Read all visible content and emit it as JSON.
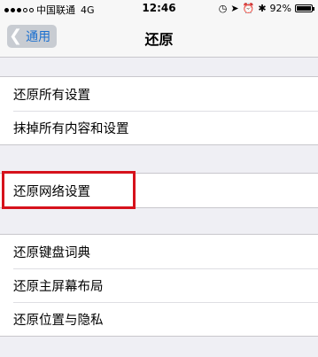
{
  "status_bar": {
    "carrier": "中国联通",
    "network": "4G",
    "time": "12:46",
    "battery": "92%"
  },
  "nav": {
    "back_label": "通用",
    "title": "还原"
  },
  "groups": [
    {
      "items": [
        "还原所有设置",
        "抹掉所有内容和设置"
      ]
    },
    {
      "items": [
        "还原网络设置"
      ]
    },
    {
      "items": [
        "还原键盘词典",
        "还原主屏幕布局",
        "还原位置与隐私"
      ]
    }
  ],
  "colors": {
    "highlight_border": "#d6121c",
    "back_text": "#1a6fd0"
  }
}
